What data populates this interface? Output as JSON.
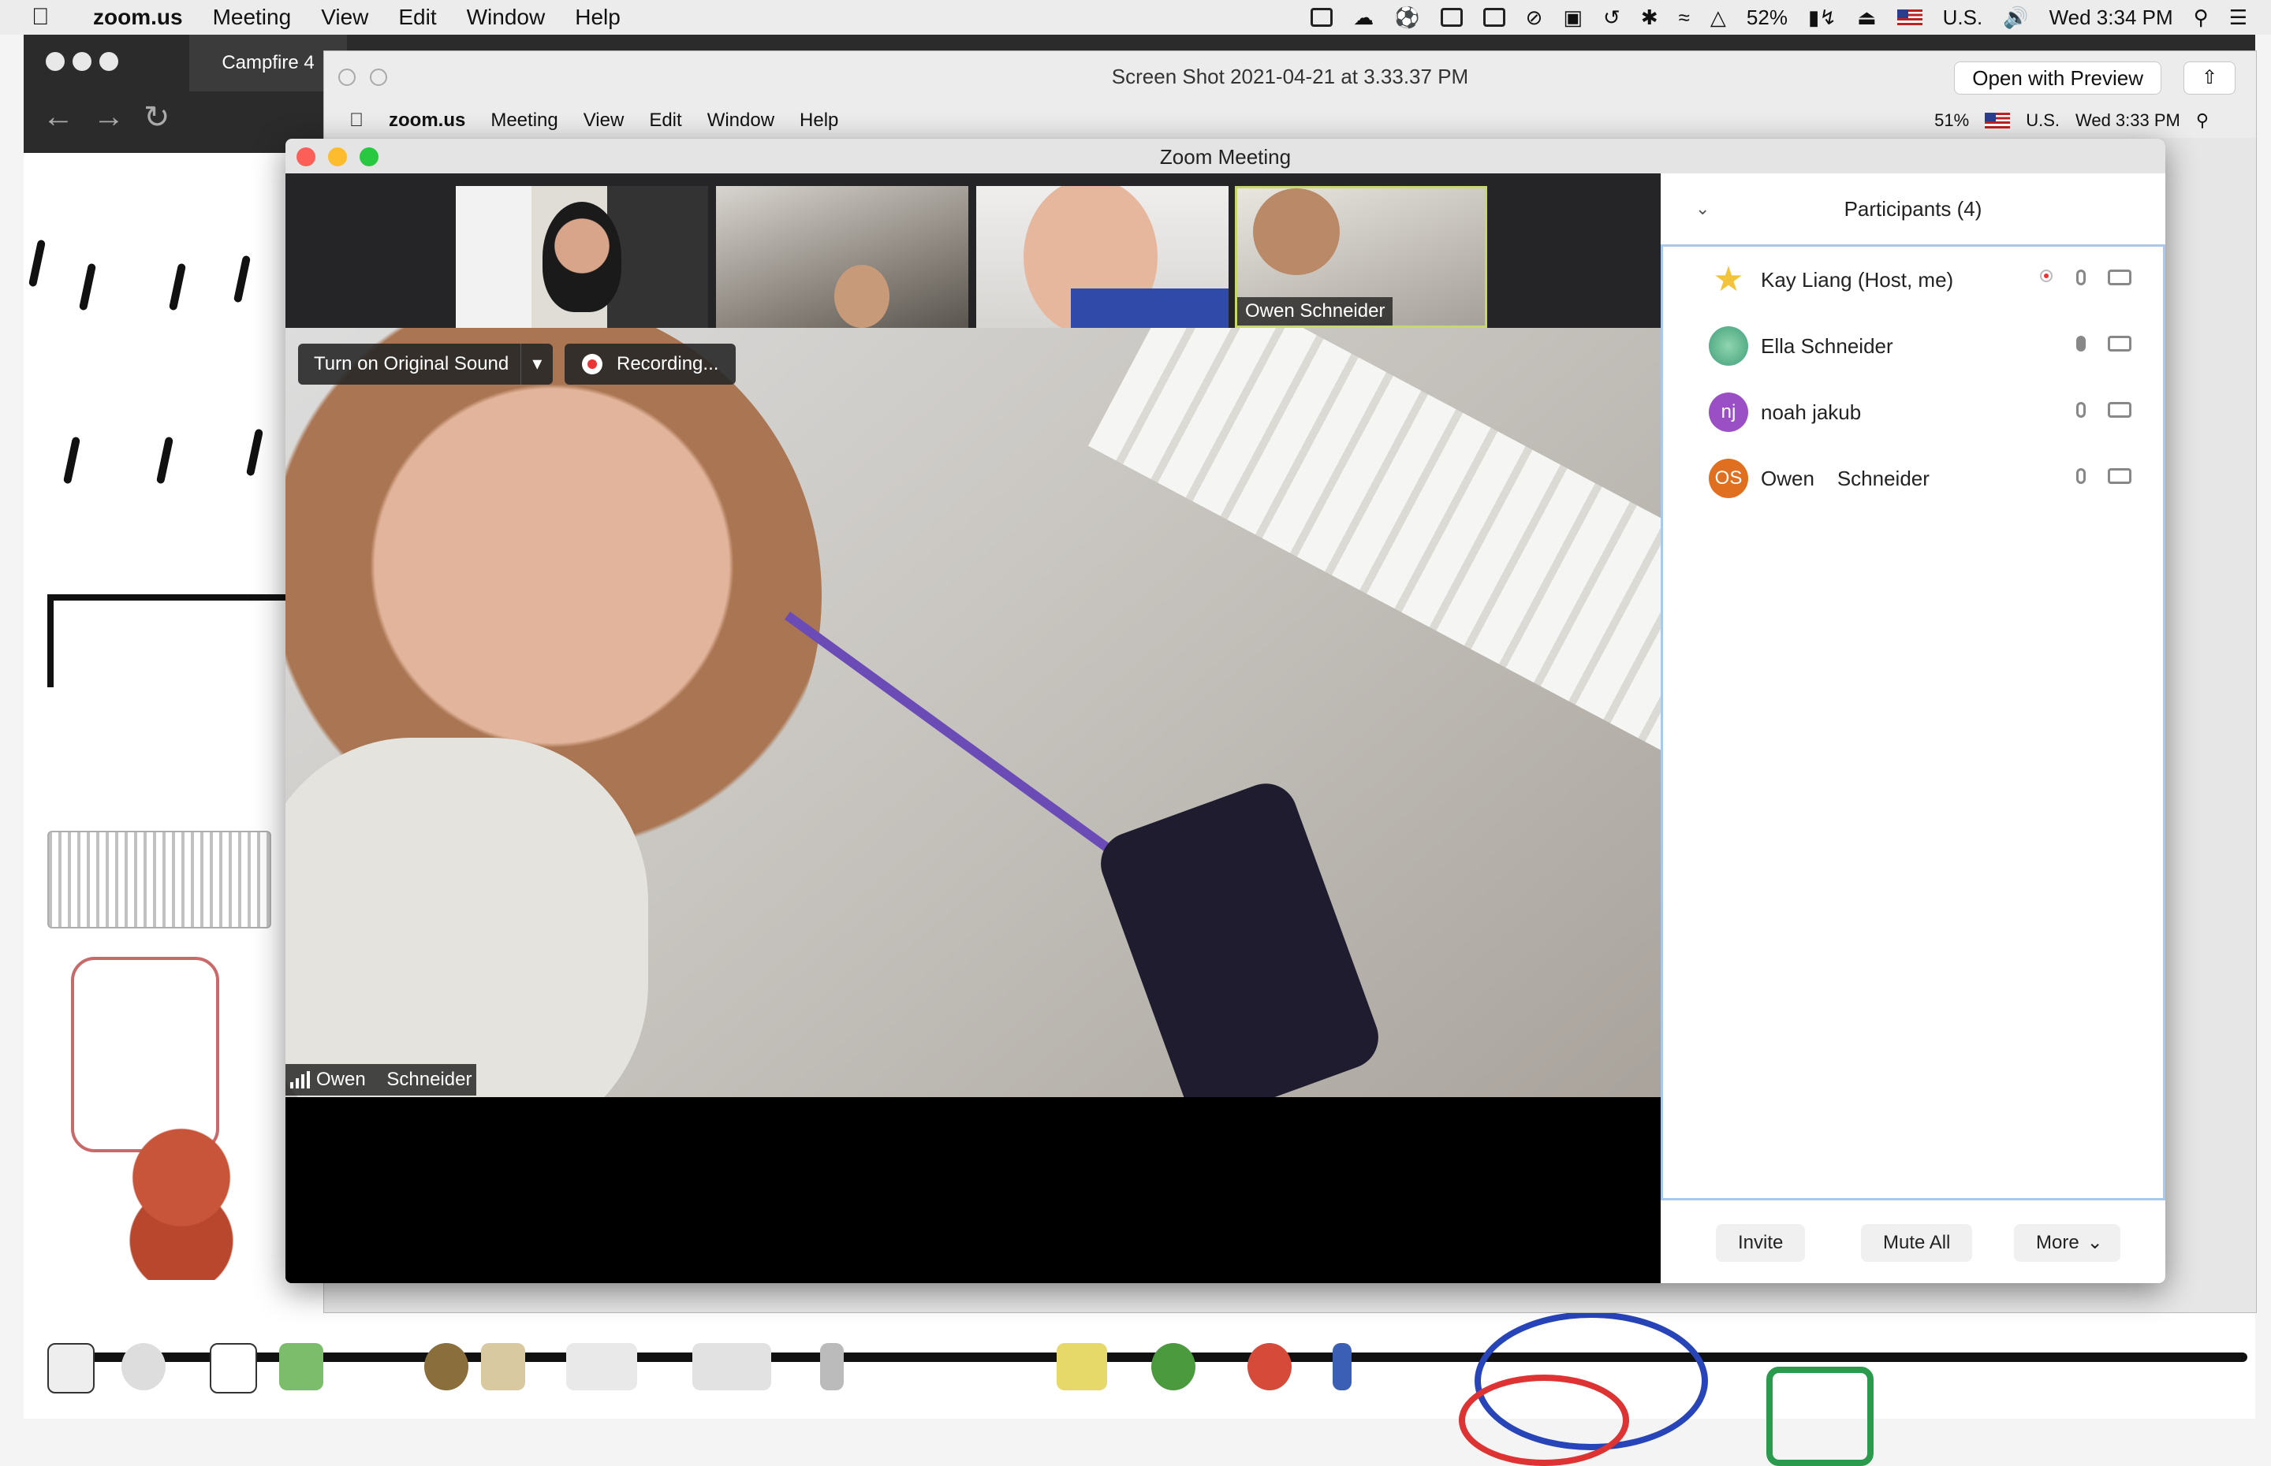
{
  "menubar": {
    "app": "zoom.us",
    "items": [
      "Meeting",
      "View",
      "Edit",
      "Window",
      "Help"
    ],
    "battery": "52%",
    "input_source": "U.S.",
    "clock": "Wed 3:34 PM"
  },
  "browser": {
    "tab_title": "Campfire 4"
  },
  "preview": {
    "title": "Screen Shot 2021-04-21 at 3.33.37 PM",
    "open_button": "Open with Preview",
    "share_icon": "share-icon"
  },
  "inner_menubar": {
    "app": "zoom.us",
    "items": [
      "Meeting",
      "View",
      "Edit",
      "Window",
      "Help"
    ],
    "battery": "51%",
    "input_source": "U.S.",
    "clock": "Wed 3:33 PM"
  },
  "zoom": {
    "window_title": "Zoom Meeting",
    "original_sound_button": "Turn on Original Sound",
    "recording_label": "Recording...",
    "main_speaker": "Owen    Schneider",
    "gallery": [
      {
        "name": ""
      },
      {
        "name": ""
      },
      {
        "name": ""
      },
      {
        "name": "Owen    Schneider"
      }
    ]
  },
  "participants": {
    "title": "Participants (4)",
    "list": [
      {
        "name": "Kay Liang (Host, me)",
        "initials": "",
        "color": "#f3c33b"
      },
      {
        "name": "Ella Schneider",
        "initials": "",
        "color": "#5bb38a"
      },
      {
        "name": "noah jakub",
        "initials": "nj",
        "color": "#9a4fc5"
      },
      {
        "name": "Owen    Schneider",
        "initials": "OS",
        "color": "#e0701f"
      }
    ],
    "invite": "Invite",
    "mute_all": "Mute All",
    "more": "More"
  }
}
